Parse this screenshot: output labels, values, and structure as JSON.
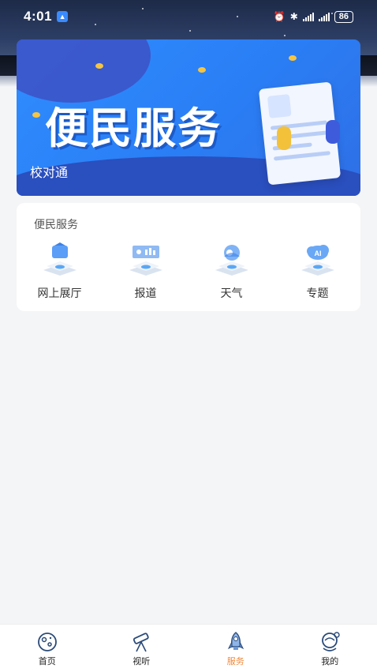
{
  "status_bar": {
    "time": "4:01",
    "battery": "86"
  },
  "banner": {
    "title": "便民服务",
    "subtitle": "校对通"
  },
  "service_section": {
    "title": "便民服务",
    "items": [
      {
        "label": "网上展厅",
        "icon": "gallery-icon"
      },
      {
        "label": "报道",
        "icon": "report-icon"
      },
      {
        "label": "天气",
        "icon": "weather-icon"
      },
      {
        "label": "专题",
        "icon": "topic-icon"
      }
    ]
  },
  "bottom_nav": {
    "items": [
      {
        "label": "首页",
        "icon": "home-planet-icon",
        "active": false
      },
      {
        "label": "视听",
        "icon": "telescope-icon",
        "active": false
      },
      {
        "label": "服务",
        "icon": "rocket-icon",
        "active": true
      },
      {
        "label": "我的",
        "icon": "astronaut-icon",
        "active": false
      }
    ],
    "active_color": "#f08a3c"
  }
}
